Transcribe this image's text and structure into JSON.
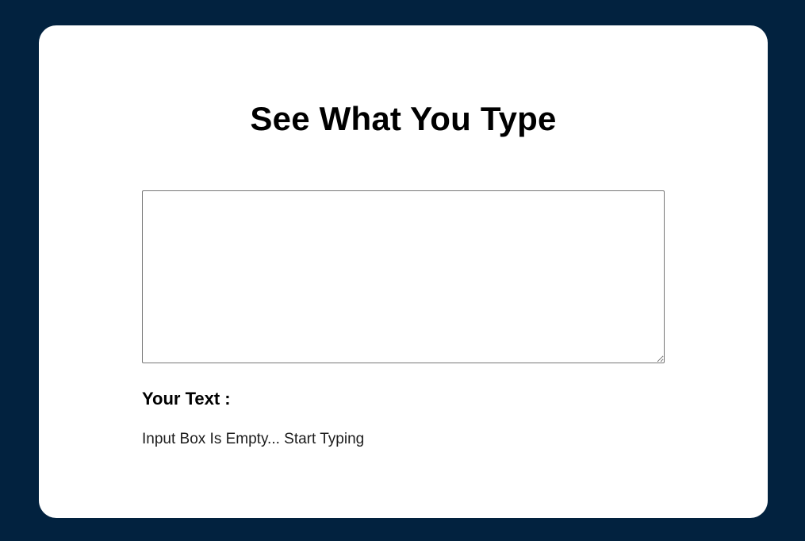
{
  "page": {
    "background_color": "#02223f",
    "card_color": "#ffffff"
  },
  "header": {
    "title": "See What You Type"
  },
  "input": {
    "value": "",
    "placeholder": ""
  },
  "output": {
    "label": "Your Text :",
    "text": "Input Box Is Empty... Start Typing"
  }
}
